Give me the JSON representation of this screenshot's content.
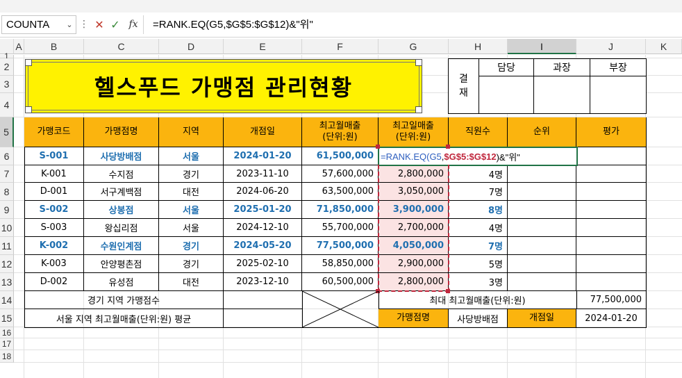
{
  "formula_bar": {
    "name_box": "COUNTA",
    "formula": "=RANK.EQ(G5,$G$5:$G$12)&\"위\"",
    "cancel_icon": "close-icon",
    "enter_icon": "check-icon",
    "fx_label": "fx"
  },
  "columns": [
    "A",
    "B",
    "C",
    "D",
    "E",
    "F",
    "G",
    "H",
    "I",
    "J",
    "K"
  ],
  "rows": [
    "1",
    "2",
    "3",
    "4",
    "5",
    "6",
    "7",
    "8",
    "9",
    "10",
    "11",
    "12",
    "13",
    "14",
    "15",
    "16",
    "17",
    "18"
  ],
  "title": "헬스푸드 가맹점 관리현황",
  "approval": {
    "label": "결\n재",
    "headers": [
      "담당",
      "과장",
      "부장"
    ]
  },
  "table": {
    "headers": [
      "가맹코드",
      "가맹점명",
      "지역",
      "개점일",
      "최고월매출\n(단위:원)",
      "최고일매출\n(단위:원)",
      "직원수",
      "순위",
      "평가"
    ],
    "rows": [
      {
        "code": "S-001",
        "name": "사당방배점",
        "region": "서울",
        "open": "2024-01-20",
        "month": "61,500,000",
        "day": "=RANK.EQ(G5,$G$5:$G$12)&\"위\"",
        "staff": "",
        "rank": "",
        "eval": "",
        "hl": true
      },
      {
        "code": "K-001",
        "name": "수지점",
        "region": "경기",
        "open": "2023-11-10",
        "month": "57,600,000",
        "day": "2,800,000",
        "staff": "4명",
        "rank": "",
        "eval": "",
        "hl": false
      },
      {
        "code": "D-001",
        "name": "서구계백점",
        "region": "대전",
        "open": "2024-06-20",
        "month": "63,500,000",
        "day": "3,050,000",
        "staff": "7명",
        "rank": "",
        "eval": "",
        "hl": false
      },
      {
        "code": "S-002",
        "name": "상봉점",
        "region": "서울",
        "open": "2025-01-20",
        "month": "71,850,000",
        "day": "3,900,000",
        "staff": "8명",
        "rank": "",
        "eval": "",
        "hl": true
      },
      {
        "code": "S-003",
        "name": "왕십리점",
        "region": "서울",
        "open": "2024-12-10",
        "month": "55,700,000",
        "day": "2,700,000",
        "staff": "4명",
        "rank": "",
        "eval": "",
        "hl": false
      },
      {
        "code": "K-002",
        "name": "수원인계점",
        "region": "경기",
        "open": "2024-05-20",
        "month": "77,500,000",
        "day": "4,050,000",
        "staff": "7명",
        "rank": "",
        "eval": "",
        "hl": true
      },
      {
        "code": "K-003",
        "name": "안양평촌점",
        "region": "경기",
        "open": "2025-02-10",
        "month": "58,850,000",
        "day": "2,900,000",
        "staff": "5명",
        "rank": "",
        "eval": "",
        "hl": false
      },
      {
        "code": "D-002",
        "name": "유성점",
        "region": "대전",
        "open": "2023-12-10",
        "month": "60,500,000",
        "day": "2,800,000",
        "staff": "3명",
        "rank": "",
        "eval": "",
        "hl": false
      }
    ]
  },
  "summary": {
    "r13_label": "경기 지역 가맹점수",
    "r13_value": "",
    "r13_mid_label": "최대 최고월매출(단위:원)",
    "r13_mid_value": "77,500,000",
    "r14_label": "서울 지역 최고월매출(단위:원) 평균",
    "r14_value": "",
    "r14_h1": "가맹점명",
    "r14_v1": "사당방배점",
    "r14_h2": "개점일",
    "r14_v2": "2024-01-20"
  },
  "edit_formula": {
    "p1": "=RANK.EQ(",
    "p2": "G5",
    "p3": ",",
    "p4": "$G$5:$G$12",
    "p5": ")&\"위\""
  },
  "colors": {
    "header_fill": "#fbb40e",
    "title_fill": "#fff200",
    "highlight_text": "#1f6fb0",
    "range_fill": "#fbe3e3",
    "ref_blue": "#2e5fbf",
    "ref_red": "#c0273d"
  }
}
